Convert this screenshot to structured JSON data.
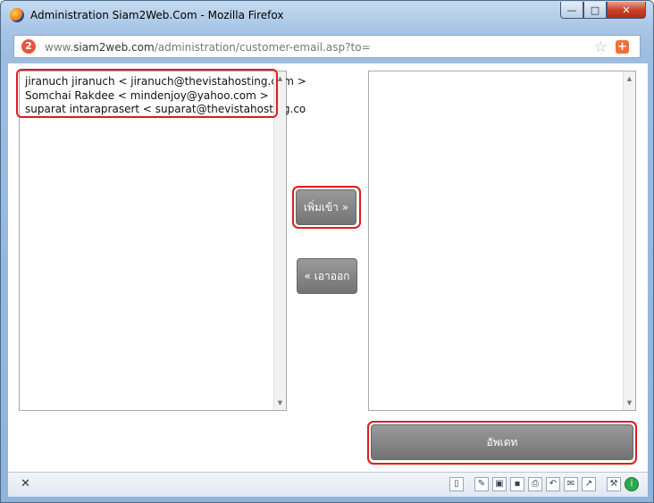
{
  "window": {
    "title": "Administration Siam2Web.Com - Mozilla Firefox",
    "minimize": "—",
    "maximize": "□",
    "close": "✕"
  },
  "address_bar": {
    "site_icon_text": "2",
    "url_prefix": "www.",
    "url_host": "siam2web.com",
    "url_path": "/administration/customer-email.asp?to=",
    "icons": [
      "star-icon",
      "add-icon"
    ]
  },
  "left_list": {
    "options": [
      "jiranuch jiranuch < jiranuch@thevistahosting.com >",
      "Somchai Rakdee < mindenjoy@yahoo.com >",
      "suparat intaraprasert < suparat@thevistahosting.co"
    ]
  },
  "right_list": {
    "options": []
  },
  "buttons": {
    "add_label": "เพิ่มเข้า »",
    "remove_label": "« เอาออก",
    "update_label": "อัพเดท"
  },
  "colors": {
    "highlight": "#e01b1b",
    "button_gray": "#838383"
  },
  "statusbar": {
    "close_text": "✕",
    "tool_icons": [
      "page-icon",
      "pencil-icon",
      "screen-icon",
      "save-icon",
      "print-icon",
      "undo-icon",
      "mail-icon",
      "chart-icon",
      "tools-icon",
      "info-icon"
    ]
  }
}
